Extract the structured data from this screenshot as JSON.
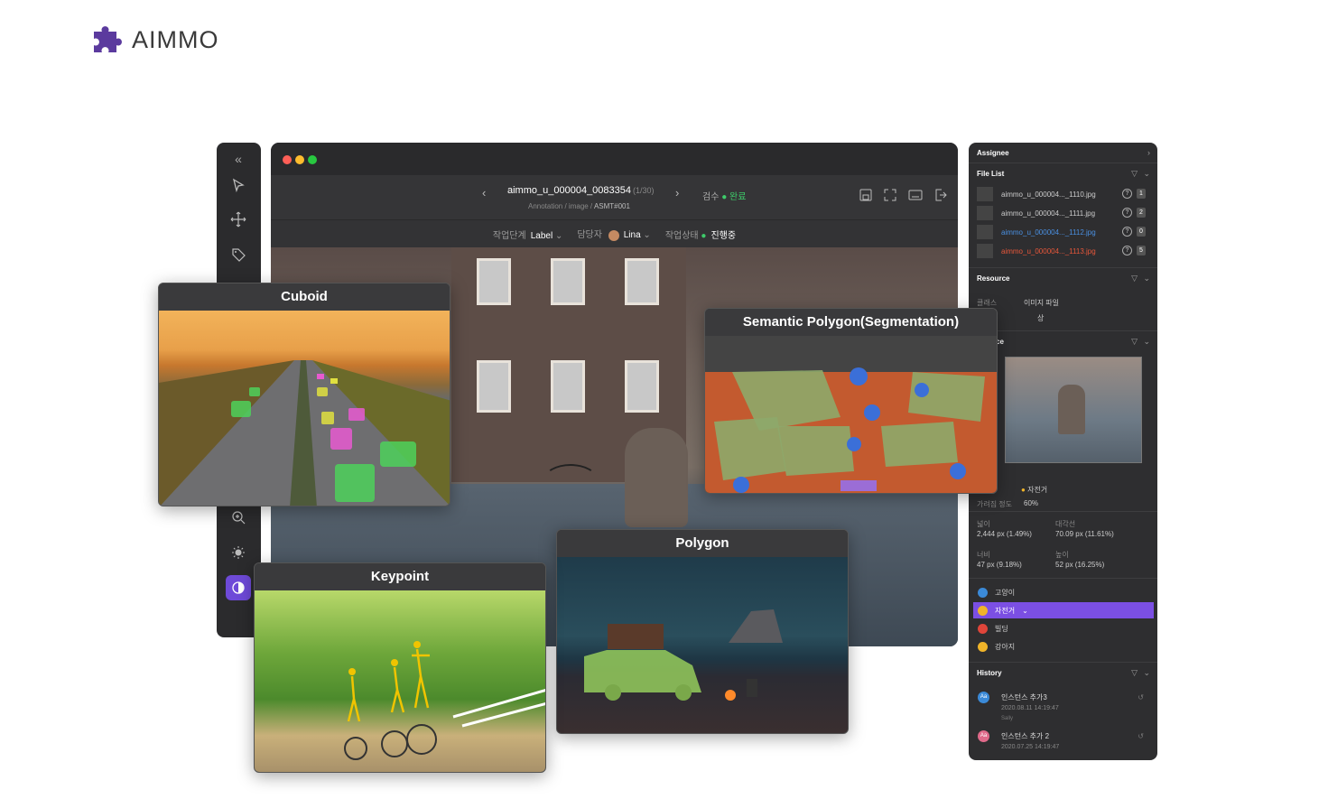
{
  "brand": {
    "name": "AIMMO",
    "color": "#5b3a9e"
  },
  "editor": {
    "file_name": "aimmo_u_000004_0083354",
    "file_count": "(1/30)",
    "breadcrumb": "Annotation / image / ",
    "assignment": "ASMT#001",
    "review_label": "검수",
    "review_status": "완료",
    "meta": {
      "stage_label": "작업단계",
      "stage_value": "Label",
      "assignee_label": "담당자",
      "assignee_value": "Lina",
      "status_label": "작업상태",
      "status_value": "진행중"
    }
  },
  "cards": {
    "cuboid": "Cuboid",
    "semantic": "Semantic Polygon(Segmentation)",
    "keypoint": "Keypoint",
    "polygon": "Polygon"
  },
  "panel": {
    "assignee": "Assignee",
    "file_list": "File List",
    "files": [
      {
        "name": "aimmo_u_000004..._1110.jpg",
        "count": "1",
        "color": "#cccccc"
      },
      {
        "name": "aimmo_u_000004..._1111.jpg",
        "count": "2",
        "color": "#cccccc"
      },
      {
        "name": "aimmo_u_000004..._1112.jpg",
        "count": "0",
        "color": "#4a90e2"
      },
      {
        "name": "aimmo_u_000004..._1113.jpg",
        "count": "5",
        "color": "#e8573a"
      }
    ],
    "resource": "Resource",
    "class_label": "클래스",
    "class_value": "이미지 파일",
    "class_sub": "상",
    "instance": "ce",
    "inst_class": "자전거",
    "confidence_label": "가려짐 정도",
    "confidence": "60%",
    "area_label": "넓이",
    "area": "2,444 px (1.49%)",
    "diag_label": "대각선",
    "diag": "70.09 px (11.61%)",
    "width_label": "너비",
    "width": "47 px (9.18%)",
    "height_label": "높이",
    "height": "52 px (16.25%)",
    "classes": [
      {
        "name": "고양이",
        "color": "#3b8ad8"
      },
      {
        "name": "자전거",
        "color": "#f0b429"
      },
      {
        "name": "빌딩",
        "color": "#e0453a"
      },
      {
        "name": "강아지",
        "color": "#f0b429"
      }
    ],
    "history": "History",
    "history_items": [
      {
        "title": "인스턴스 추가3",
        "date": "2020.08.11 14:19:47",
        "user": "Sally",
        "avatar": "Aa",
        "color": "#3b8ad8"
      },
      {
        "title": "인스턴스 추가 2",
        "date": "2020.07.25 14:19:47",
        "user": "",
        "avatar": "Aa",
        "color": "#e06a8a"
      }
    ]
  }
}
